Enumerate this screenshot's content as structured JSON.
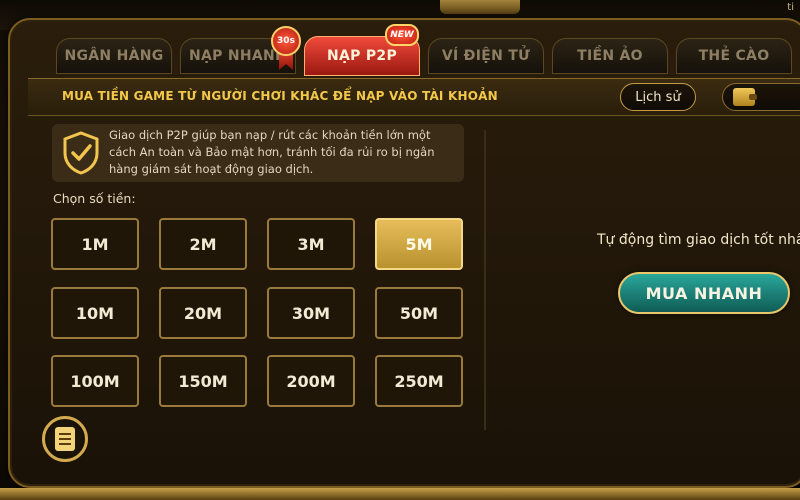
{
  "tabs": [
    {
      "label": "NGÂN HÀNG",
      "active": false
    },
    {
      "label": "NẠP NHANH",
      "active": false,
      "badge": "30s"
    },
    {
      "label": "NẠP P2P",
      "active": true,
      "badge": "NEW"
    },
    {
      "label": "VÍ ĐIỆN TỬ",
      "active": false
    },
    {
      "label": "TIỀN ẢO",
      "active": false
    },
    {
      "label": "THẺ CÀO",
      "active": false
    }
  ],
  "header": {
    "title": "MUA TIỀN GAME TỪ NGƯỜI CHƠI KHÁC ĐỂ NẠP VÀO TÀI KHOẢN",
    "history_label": "Lịch sử"
  },
  "notice": {
    "icon": "shield-check-icon",
    "text": "Giao dịch P2P giúp bạn nạp / rút các khoản tiền lớn một cách An toàn và Bảo mật hơn, tránh tối đa rủi ro bị ngân hàng giám sát hoạt động giao dịch."
  },
  "amounts": {
    "label": "Chọn số tiền:",
    "options": [
      "1M",
      "2M",
      "3M",
      "5M",
      "10M",
      "20M",
      "30M",
      "50M",
      "100M",
      "150M",
      "200M",
      "250M"
    ],
    "selected": "5M"
  },
  "right_panel": {
    "auto_text": "Tự động tìm giao dịch tốt nhấ",
    "quick_buy_label": "MUA NHANH"
  },
  "corner_text": "ti",
  "colors": {
    "accent_gold": "#f3c84a",
    "active_tab": "#d8321f",
    "quick_buy": "#1d8a80"
  }
}
